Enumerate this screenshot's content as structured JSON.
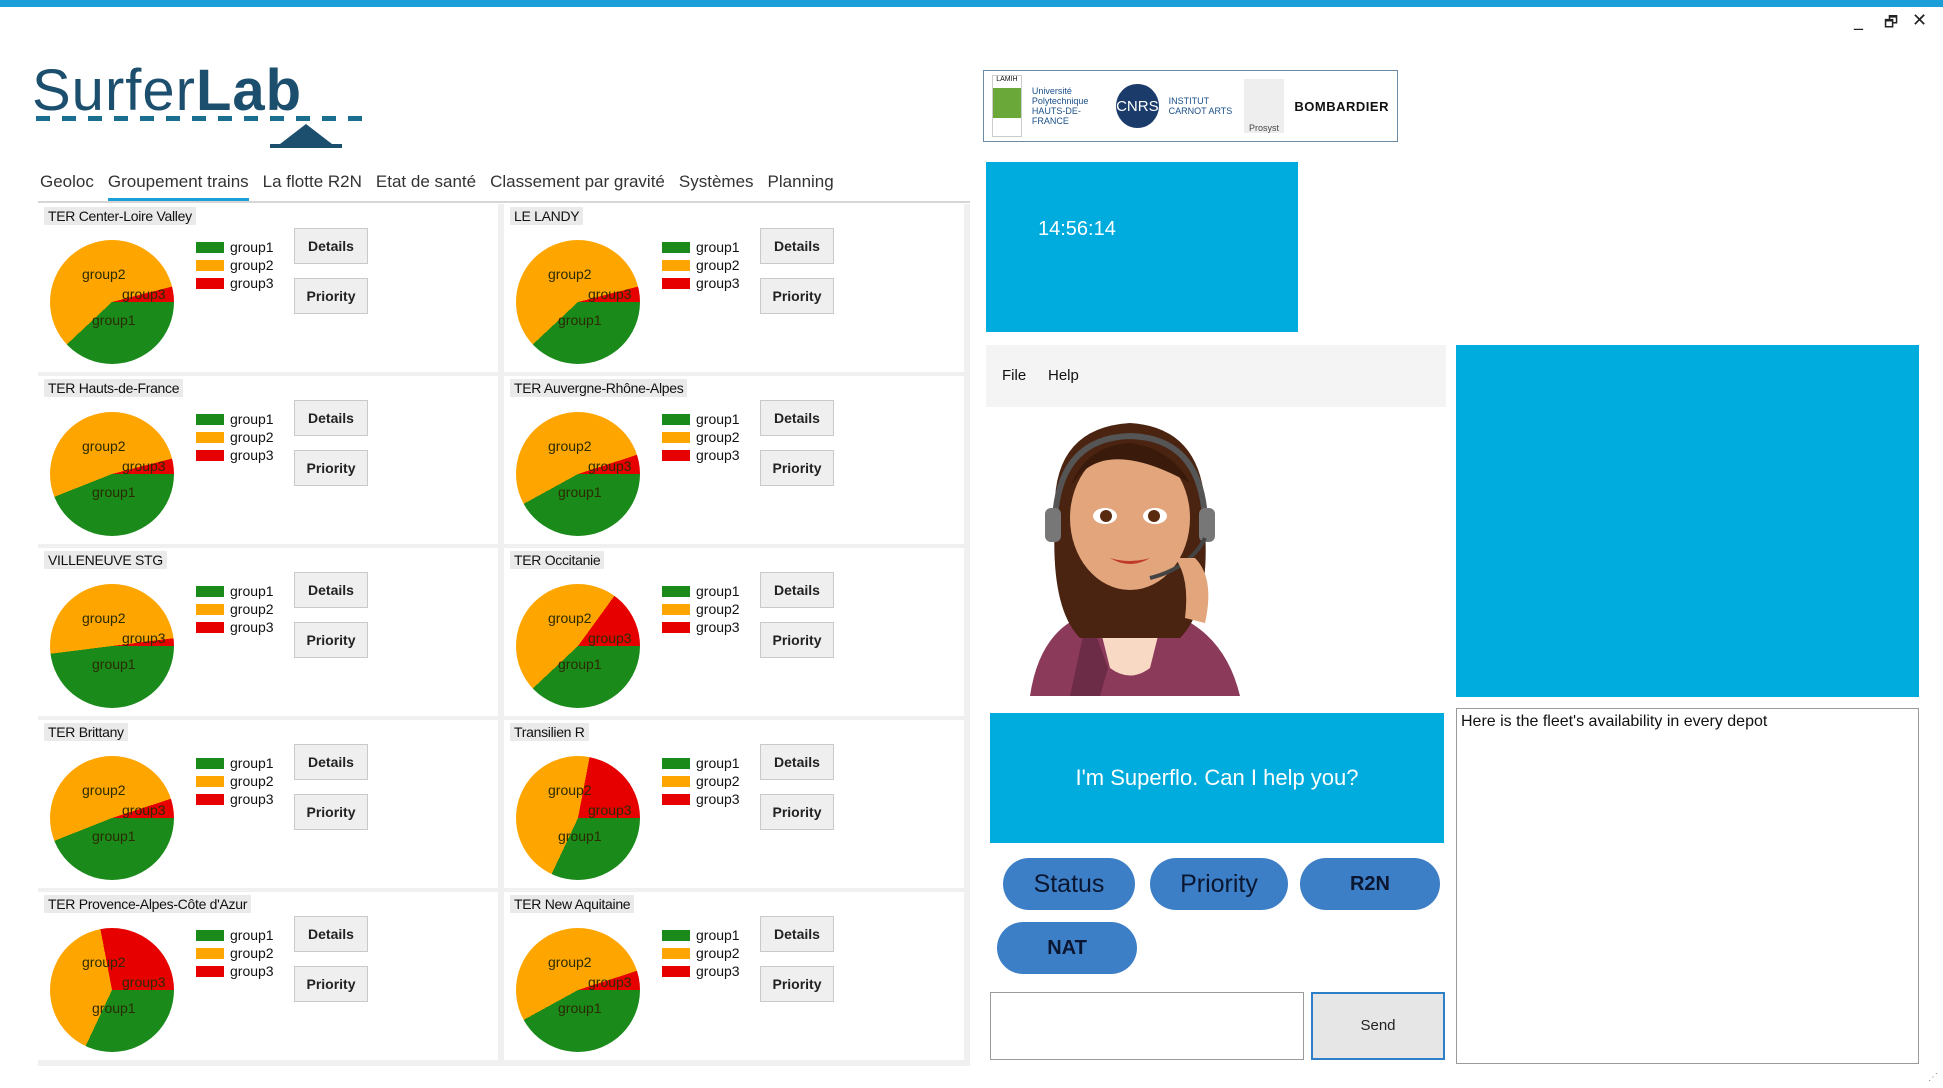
{
  "window": {
    "controls": {
      "minimize": "_",
      "restore": "🗗",
      "close": "✕"
    }
  },
  "logo": {
    "part1": "Surfer",
    "part2": "Lab"
  },
  "partners": {
    "lamih": "LAMIH",
    "uphf": "Université Polytechnique HAUTS-DE-FRANCE",
    "cnrs": "CNRS",
    "carnot": "INSTITUT CARNOT ARTS",
    "prosyst": "Prosyst",
    "bombardier": "BOMBARDIER"
  },
  "tabs": [
    {
      "label": "Geoloc"
    },
    {
      "label": "Groupement trains"
    },
    {
      "label": "La flotte R2N"
    },
    {
      "label": "Etat de santé"
    },
    {
      "label": "Classement par gravité"
    },
    {
      "label": "Systèmes"
    },
    {
      "label": "Planning"
    }
  ],
  "colors": {
    "group1": "#1a8a1a",
    "group2": "#ffa500",
    "group3": "#e60000",
    "accent": "#00acdd",
    "button_blue": "#3d7fc6"
  },
  "legend": [
    "group1",
    "group2",
    "group3"
  ],
  "buttons": {
    "details": "Details",
    "priority": "Priority"
  },
  "depots": [
    {
      "name": "TER Center-Loire Valley",
      "pie_labels": [
        "group2",
        "group3",
        "group1"
      ],
      "shares": {
        "group1": 38,
        "group2": 58,
        "group3": 4
      }
    },
    {
      "name": "LE LANDY",
      "pie_labels": [
        "group2",
        "group3",
        "group1"
      ],
      "shares": {
        "group1": 38,
        "group2": 58,
        "group3": 4
      }
    },
    {
      "name": "TER Hauts-de-France",
      "pie_labels": [
        "group2",
        "group3",
        "group1"
      ],
      "shares": {
        "group1": 44,
        "group2": 52,
        "group3": 4
      }
    },
    {
      "name": "TER Auvergne-Rhône-Alpes",
      "pie_labels": [
        "group2",
        "group3",
        "group1"
      ],
      "shares": {
        "group1": 42,
        "group2": 53,
        "group3": 5
      }
    },
    {
      "name": "VILLENEUVE STG",
      "pie_labels": [
        "group2",
        "group3",
        "group1"
      ],
      "shares": {
        "group1": 48,
        "group2": 50,
        "group3": 2
      }
    },
    {
      "name": "TER Occitanie",
      "pie_labels": [
        "group2",
        "group3",
        "group1"
      ],
      "shares": {
        "group1": 38,
        "group2": 47,
        "group3": 15
      }
    },
    {
      "name": "TER Brittany",
      "pie_labels": [
        "group2",
        "group3",
        "group1"
      ],
      "shares": {
        "group1": 44,
        "group2": 51,
        "group3": 5
      }
    },
    {
      "name": "Transilien R",
      "pie_labels": [
        "group2",
        "group3",
        "group1"
      ],
      "shares": {
        "group1": 32,
        "group2": 46,
        "group3": 22
      }
    },
    {
      "name": "TER Provence-Alpes-Côte d'Azur",
      "pie_labels": [
        "group2",
        "group3",
        "group1"
      ],
      "shares": {
        "group1": 32,
        "group2": 40,
        "group3": 28
      }
    },
    {
      "name": "TER New Aquitaine",
      "pie_labels": [
        "group2",
        "group3",
        "group1"
      ],
      "shares": {
        "group1": 42,
        "group2": 53,
        "group3": 5
      }
    }
  ],
  "clock": {
    "time": "14:56:14"
  },
  "menu": {
    "file": "File",
    "help": "Help"
  },
  "assistant": {
    "greeting": "I'm Superflo. Can I help you?",
    "quick_buttons": [
      "Status",
      "Priority",
      "R2N",
      "NAT"
    ],
    "input_value": "",
    "send_label": "Send",
    "response": "Here is the fleet's availability in every depot"
  }
}
